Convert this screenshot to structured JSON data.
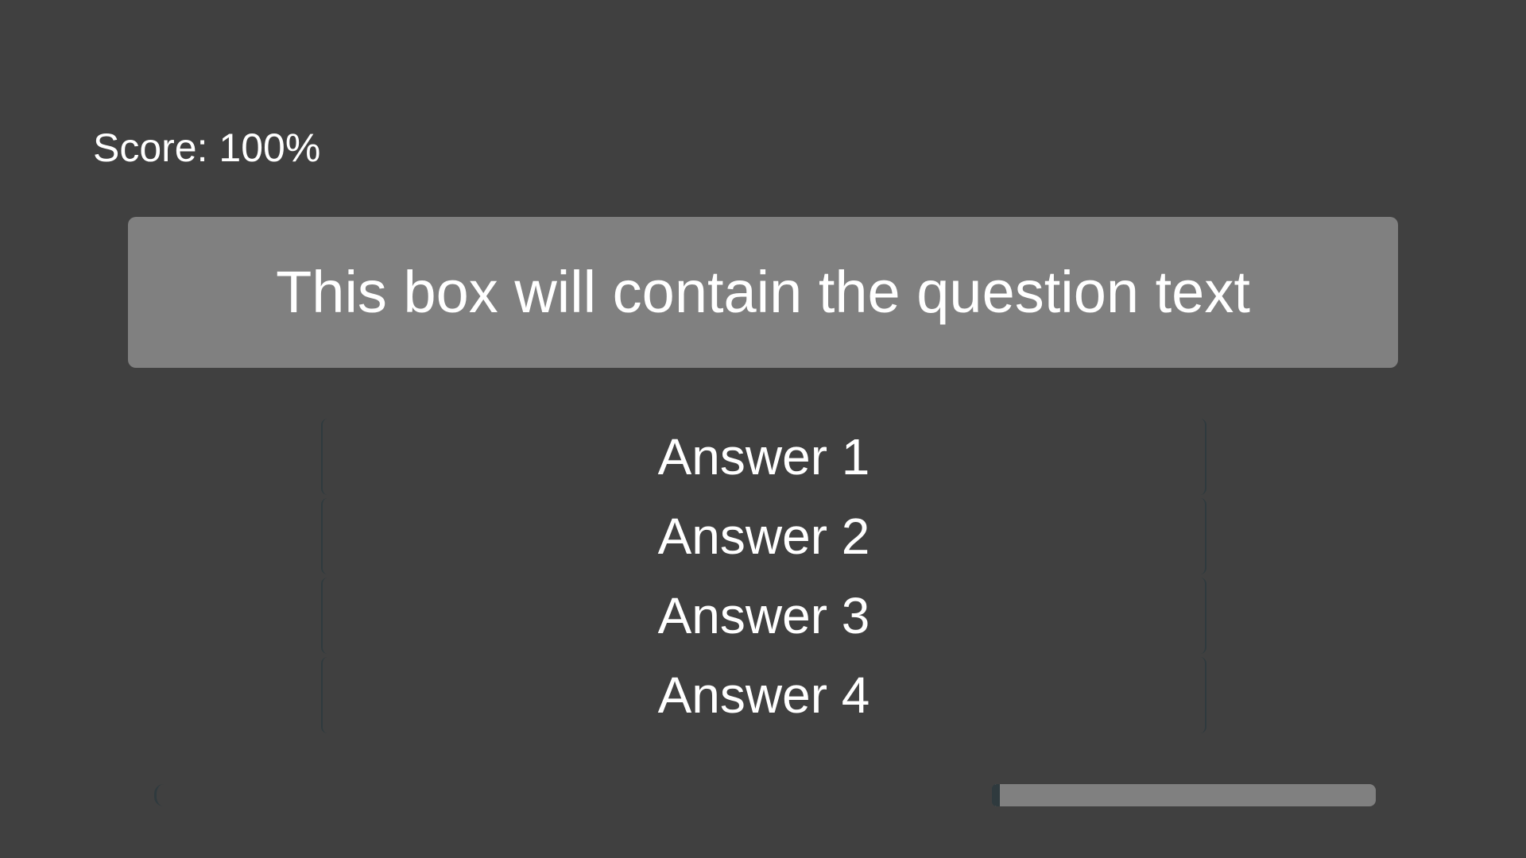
{
  "hud": {
    "score_text": "Score: 100%"
  },
  "question": {
    "text": "This box will contain the question text"
  },
  "answers": [
    {
      "label": "Answer 1"
    },
    {
      "label": "Answer 2"
    },
    {
      "label": "Answer 3"
    },
    {
      "label": "Answer 4"
    }
  ],
  "timer": {
    "remaining_fraction": 0.31
  },
  "colors": {
    "background": "#404040",
    "panel": "#808080",
    "text": "#ffffff",
    "outline": "#2f3a3e"
  }
}
